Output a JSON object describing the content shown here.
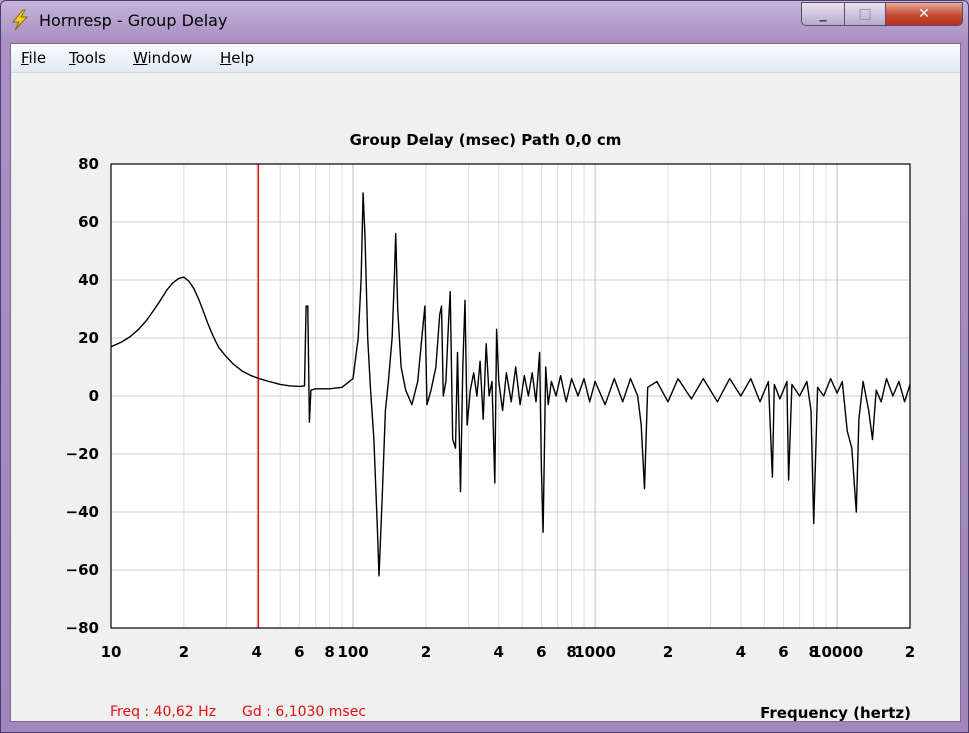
{
  "window": {
    "title": "Hornresp - Group Delay",
    "controls": {
      "minimize": "_",
      "maximize": "□",
      "close": "✕"
    }
  },
  "menu": [
    {
      "label_first": "F",
      "label_rest": "ile"
    },
    {
      "label_first": "T",
      "label_rest": "ools"
    },
    {
      "label_first": "W",
      "label_rest": "indow"
    },
    {
      "label_first": "H",
      "label_rest": "elp"
    }
  ],
  "chart_data": {
    "type": "line",
    "title": "Group Delay (msec)   Path 0,0 cm",
    "xlabel": "Frequency (hertz)",
    "ylabel": "",
    "x_scale": "log",
    "xlim": [
      10,
      20000
    ],
    "ylim": [
      -80,
      80
    ],
    "y_ticks": [
      "80",
      "60",
      "40",
      "20",
      "0",
      "−20",
      "−40",
      "−60",
      "−80"
    ],
    "x_ticks": [
      {
        "value": 10,
        "label": "10"
      },
      {
        "value": 20,
        "label": "2"
      },
      {
        "value": 40,
        "label": "4"
      },
      {
        "value": 60,
        "label": "6"
      },
      {
        "value": 80,
        "label": "8"
      },
      {
        "value": 100,
        "label": "100"
      },
      {
        "value": 200,
        "label": "2"
      },
      {
        "value": 400,
        "label": "4"
      },
      {
        "value": 600,
        "label": "6"
      },
      {
        "value": 800,
        "label": "8"
      },
      {
        "value": 1000,
        "label": "1000"
      },
      {
        "value": 2000,
        "label": "2"
      },
      {
        "value": 4000,
        "label": "4"
      },
      {
        "value": 6000,
        "label": "6"
      },
      {
        "value": 8000,
        "label": "8"
      },
      {
        "value": 10000,
        "label": "10000"
      },
      {
        "value": 20000,
        "label": "2"
      }
    ],
    "grid": true,
    "cursor_x": 40.62,
    "cursor_color": "#e01010",
    "series": [
      {
        "color": "#000000",
        "points": [
          [
            10,
            17
          ],
          [
            11,
            18.5
          ],
          [
            12,
            20.5
          ],
          [
            13,
            23
          ],
          [
            14,
            26
          ],
          [
            15,
            29.5
          ],
          [
            16,
            33
          ],
          [
            17,
            36.5
          ],
          [
            18,
            39
          ],
          [
            19,
            40.5
          ],
          [
            20,
            41
          ],
          [
            21,
            39.5
          ],
          [
            22,
            37
          ],
          [
            23,
            33.5
          ],
          [
            24,
            29.5
          ],
          [
            25,
            25.5
          ],
          [
            26,
            22
          ],
          [
            27,
            19
          ],
          [
            28,
            16.5
          ],
          [
            30,
            13.5
          ],
          [
            32,
            11
          ],
          [
            35,
            8.5
          ],
          [
            38,
            7
          ],
          [
            40.62,
            6.1
          ],
          [
            45,
            5
          ],
          [
            50,
            4
          ],
          [
            55,
            3.5
          ],
          [
            60,
            3.3
          ],
          [
            63,
            3.5
          ],
          [
            64,
            31
          ],
          [
            65,
            31
          ],
          [
            66,
            -9
          ],
          [
            67,
            2
          ],
          [
            70,
            2.5
          ],
          [
            80,
            2.5
          ],
          [
            90,
            3
          ],
          [
            100,
            6
          ],
          [
            105,
            20
          ],
          [
            108,
            40
          ],
          [
            110,
            70
          ],
          [
            112,
            55
          ],
          [
            115,
            20
          ],
          [
            118,
            3
          ],
          [
            122,
            -15
          ],
          [
            126,
            -45
          ],
          [
            128,
            -62
          ],
          [
            132,
            -35
          ],
          [
            136,
            -5
          ],
          [
            140,
            5
          ],
          [
            145,
            20
          ],
          [
            148,
            40
          ],
          [
            150,
            56
          ],
          [
            153,
            30
          ],
          [
            158,
            10
          ],
          [
            165,
            2
          ],
          [
            175,
            -3
          ],
          [
            185,
            5
          ],
          [
            195,
            25
          ],
          [
            198,
            31
          ],
          [
            202,
            -3
          ],
          [
            210,
            2
          ],
          [
            220,
            10
          ],
          [
            228,
            28
          ],
          [
            232,
            31
          ],
          [
            236,
            0
          ],
          [
            242,
            5
          ],
          [
            248,
            25
          ],
          [
            252,
            36
          ],
          [
            258,
            -15
          ],
          [
            265,
            -18
          ],
          [
            270,
            15
          ],
          [
            278,
            -33
          ],
          [
            284,
            10
          ],
          [
            290,
            33
          ],
          [
            296,
            -10
          ],
          [
            305,
            2
          ],
          [
            315,
            8
          ],
          [
            325,
            0
          ],
          [
            335,
            12
          ],
          [
            345,
            -8
          ],
          [
            355,
            18
          ],
          [
            365,
            0
          ],
          [
            375,
            5
          ],
          [
            385,
            -30
          ],
          [
            392,
            23
          ],
          [
            400,
            5
          ],
          [
            415,
            -5
          ],
          [
            430,
            8
          ],
          [
            450,
            -2
          ],
          [
            470,
            10
          ],
          [
            490,
            -3
          ],
          [
            510,
            7
          ],
          [
            530,
            0
          ],
          [
            550,
            8
          ],
          [
            570,
            -2
          ],
          [
            590,
            15
          ],
          [
            600,
            -25
          ],
          [
            610,
            -47
          ],
          [
            625,
            10
          ],
          [
            640,
            -3
          ],
          [
            660,
            5
          ],
          [
            690,
            0
          ],
          [
            720,
            7
          ],
          [
            760,
            -2
          ],
          [
            800,
            6
          ],
          [
            850,
            0
          ],
          [
            900,
            6
          ],
          [
            950,
            -2
          ],
          [
            1000,
            5
          ],
          [
            1100,
            -3
          ],
          [
            1200,
            6
          ],
          [
            1300,
            -2
          ],
          [
            1400,
            6
          ],
          [
            1500,
            0
          ],
          [
            1550,
            -10
          ],
          [
            1600,
            -32
          ],
          [
            1650,
            3
          ],
          [
            1800,
            5
          ],
          [
            2000,
            -2
          ],
          [
            2200,
            6
          ],
          [
            2500,
            -1
          ],
          [
            2800,
            6
          ],
          [
            3200,
            -2
          ],
          [
            3600,
            6
          ],
          [
            4000,
            0
          ],
          [
            4400,
            6
          ],
          [
            4800,
            -2
          ],
          [
            5200,
            5
          ],
          [
            5400,
            -28
          ],
          [
            5500,
            4
          ],
          [
            5800,
            -1
          ],
          [
            6200,
            5
          ],
          [
            6300,
            -29
          ],
          [
            6500,
            4
          ],
          [
            7000,
            0
          ],
          [
            7500,
            5
          ],
          [
            7800,
            -5
          ],
          [
            8000,
            -44
          ],
          [
            8300,
            3
          ],
          [
            8800,
            0
          ],
          [
            9400,
            6
          ],
          [
            10000,
            1
          ],
          [
            10500,
            5
          ],
          [
            11000,
            -12
          ],
          [
            11500,
            -18
          ],
          [
            12000,
            -40
          ],
          [
            12300,
            -8
          ],
          [
            12800,
            5
          ],
          [
            13500,
            -5
          ],
          [
            14000,
            -15
          ],
          [
            14500,
            2
          ],
          [
            15200,
            -2
          ],
          [
            16000,
            6
          ],
          [
            17000,
            0
          ],
          [
            18000,
            5
          ],
          [
            19000,
            -2
          ],
          [
            20000,
            4
          ]
        ]
      }
    ]
  },
  "readout": {
    "freq": "Freq : 40,62 Hz",
    "gd": "Gd : 6,1030 msec"
  }
}
